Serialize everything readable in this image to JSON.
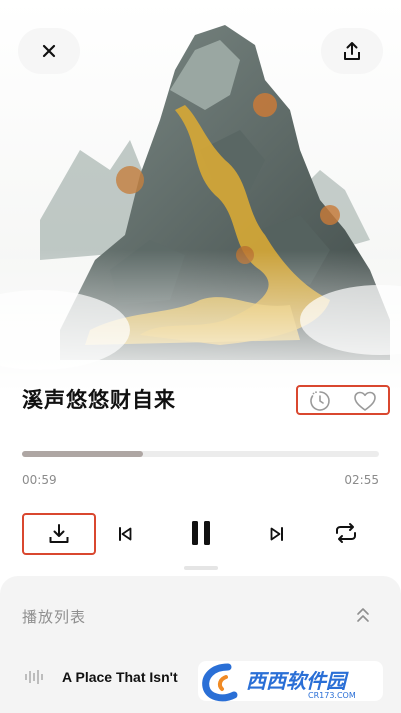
{
  "header": {
    "close_icon": "close-icon",
    "share_icon": "share-icon"
  },
  "track": {
    "title": "溪声悠悠财自来",
    "progress": 0.34,
    "elapsed": "00:59",
    "duration": "02:55"
  },
  "track_actions": {
    "timer_icon": "sleep-timer-icon",
    "like_icon": "heart-icon"
  },
  "controls": {
    "download_icon": "download-icon",
    "prev_icon": "skip-previous-icon",
    "play_pause_icon": "pause-icon",
    "next_icon": "skip-next-icon",
    "repeat_icon": "repeat-icon"
  },
  "playlist": {
    "title": "播放列表",
    "collapse_icon": "chevron-double-up-icon",
    "items": [
      {
        "title": "A Place That Isn't",
        "icon": "waveform-icon"
      }
    ]
  },
  "watermark": {
    "text": "西西软件园",
    "sub": "CR173.COM"
  },
  "colors": {
    "highlight": "#d9472f",
    "progress_fill": "#aea6a3",
    "progress_track": "#ececec",
    "text_primary": "#111111",
    "text_secondary": "#8b8b8b",
    "sheet_bg": "#f4f4f4",
    "accent_blue": "#2a6fd6",
    "accent_orange": "#f08a24"
  }
}
